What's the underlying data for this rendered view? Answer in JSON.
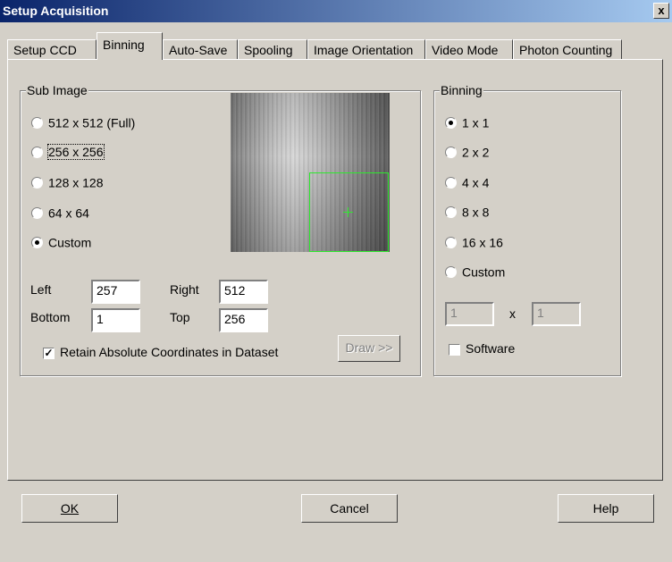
{
  "window": {
    "title": "Setup Acquisition",
    "close_glyph": "x"
  },
  "tabs": [
    {
      "label": "Setup CCD"
    },
    {
      "label": "Binning"
    },
    {
      "label": "Auto-Save"
    },
    {
      "label": "Spooling"
    },
    {
      "label": "Image Orientation"
    },
    {
      "label": "Video Mode"
    },
    {
      "label": "Photon Counting"
    }
  ],
  "sub_image": {
    "group_label": "Sub Image",
    "options": [
      {
        "label": "512 x 512 (Full)",
        "selected": false
      },
      {
        "label": "256 x 256",
        "selected": false
      },
      {
        "label": "128 x 128",
        "selected": false
      },
      {
        "label": "64 x 64",
        "selected": false
      },
      {
        "label": "Custom",
        "selected": true
      }
    ],
    "left_label": "Left",
    "left_value": "257",
    "right_label": "Right",
    "right_value": "512",
    "bottom_label": "Bottom",
    "bottom_value": "1",
    "top_label": "Top",
    "top_value": "256",
    "retain_label": "Retain Absolute Coordinates in Dataset",
    "retain_checked": true,
    "draw_label": "Draw >>",
    "roi_color": "#2ee82e"
  },
  "binning": {
    "group_label": "Binning",
    "options": [
      {
        "label": "1 x 1",
        "selected": true
      },
      {
        "label": "2 x 2",
        "selected": false
      },
      {
        "label": "4 x 4",
        "selected": false
      },
      {
        "label": "8 x 8",
        "selected": false
      },
      {
        "label": "16 x 16",
        "selected": false
      },
      {
        "label": "Custom",
        "selected": false
      }
    ],
    "custom_x": "1",
    "times": "x",
    "custom_y": "1",
    "software_label": "Software",
    "software_checked": false
  },
  "buttons": {
    "ok": "OK",
    "cancel": "Cancel",
    "help": "Help"
  },
  "colors": {
    "dialog_bg": "#d4d0c8",
    "title_start": "#0a246a",
    "title_end": "#a6caf0"
  }
}
